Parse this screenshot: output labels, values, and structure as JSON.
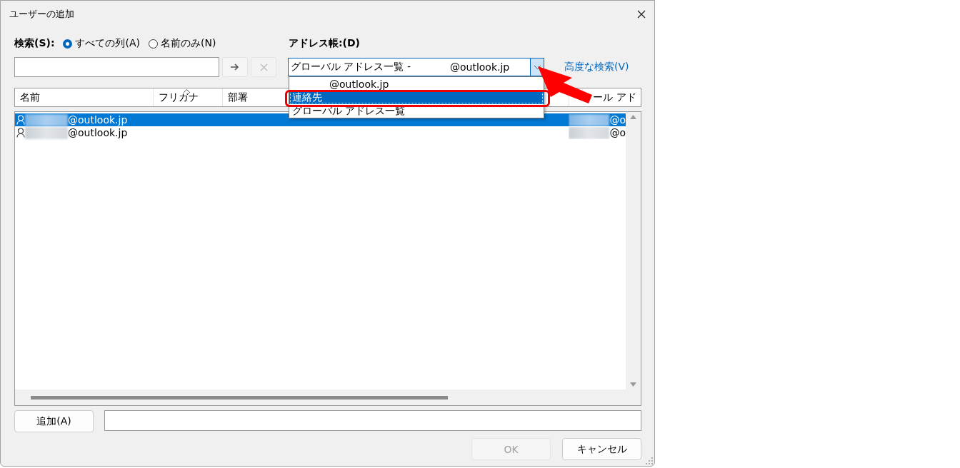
{
  "window": {
    "title": "ユーザーの追加"
  },
  "search": {
    "label": "検索(S):",
    "options": [
      {
        "label": "すべての列(A)",
        "selected": true
      },
      {
        "label": "名前のみ(N)",
        "selected": false
      }
    ],
    "buttons": [
      {
        "kind": "go",
        "disabled": false
      },
      {
        "kind": "clear",
        "disabled": true
      }
    ]
  },
  "address_book": {
    "label": "アドレス帳:(D)",
    "value": [
      "グローバル アドレス一覧 -",
      "@outlook.jp"
    ],
    "expanded": true,
    "options": [
      {
        "label": "@outlook.jp",
        "redacted_prefix": true,
        "selected": false
      },
      {
        "label": "連絡先",
        "redacted_prefix": false,
        "selected": true
      },
      {
        "label": "グローバル アドレス一覧",
        "redacted_prefix": false,
        "selected": false
      }
    ]
  },
  "advanced_search": "高度な検索(V)",
  "table": {
    "columns": [
      {
        "label": "名前",
        "sorted": false
      },
      {
        "label": "フリガナ",
        "sorted": true
      },
      {
        "label": "部署",
        "sorted": false
      },
      {
        "label": "ール アド",
        "sorted": false
      }
    ],
    "rows": [
      {
        "name": "@outlook.jp",
        "email": "@o",
        "selected": true
      },
      {
        "name": "@outlook.jp",
        "email": "@o",
        "selected": false
      }
    ]
  },
  "add_button": "追加(A)",
  "buttons": [
    {
      "label": "OK",
      "disabled": true
    },
    {
      "label": "キャンセル",
      "disabled": false
    }
  ],
  "annotations": {
    "highlight": true,
    "arrow": true
  }
}
